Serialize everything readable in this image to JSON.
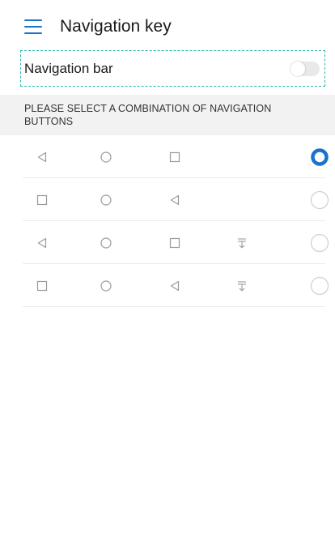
{
  "header": {
    "title": "Navigation key",
    "menu_icon": "menu-icon"
  },
  "navigation_bar": {
    "label": "Navigation bar",
    "toggle_on": false
  },
  "section": {
    "title": "PLEASE SELECT A COMBINATION OF NAVIGATION BUTTONS"
  },
  "combinations": [
    {
      "buttons": [
        "back-icon",
        "home-icon",
        "recents-icon"
      ],
      "selected": true
    },
    {
      "buttons": [
        "recents-icon",
        "home-icon",
        "back-icon"
      ],
      "selected": false
    },
    {
      "buttons": [
        "back-icon",
        "home-icon",
        "recents-icon",
        "notification-pull-icon"
      ],
      "selected": false
    },
    {
      "buttons": [
        "recents-icon",
        "home-icon",
        "back-icon",
        "notification-pull-icon"
      ],
      "selected": false
    }
  ],
  "colors": {
    "accent": "#1a73c8",
    "dashed_highlight": "#2bb3ad",
    "icon_gray": "#9a9a9a",
    "section_bg": "#f2f2f2"
  }
}
